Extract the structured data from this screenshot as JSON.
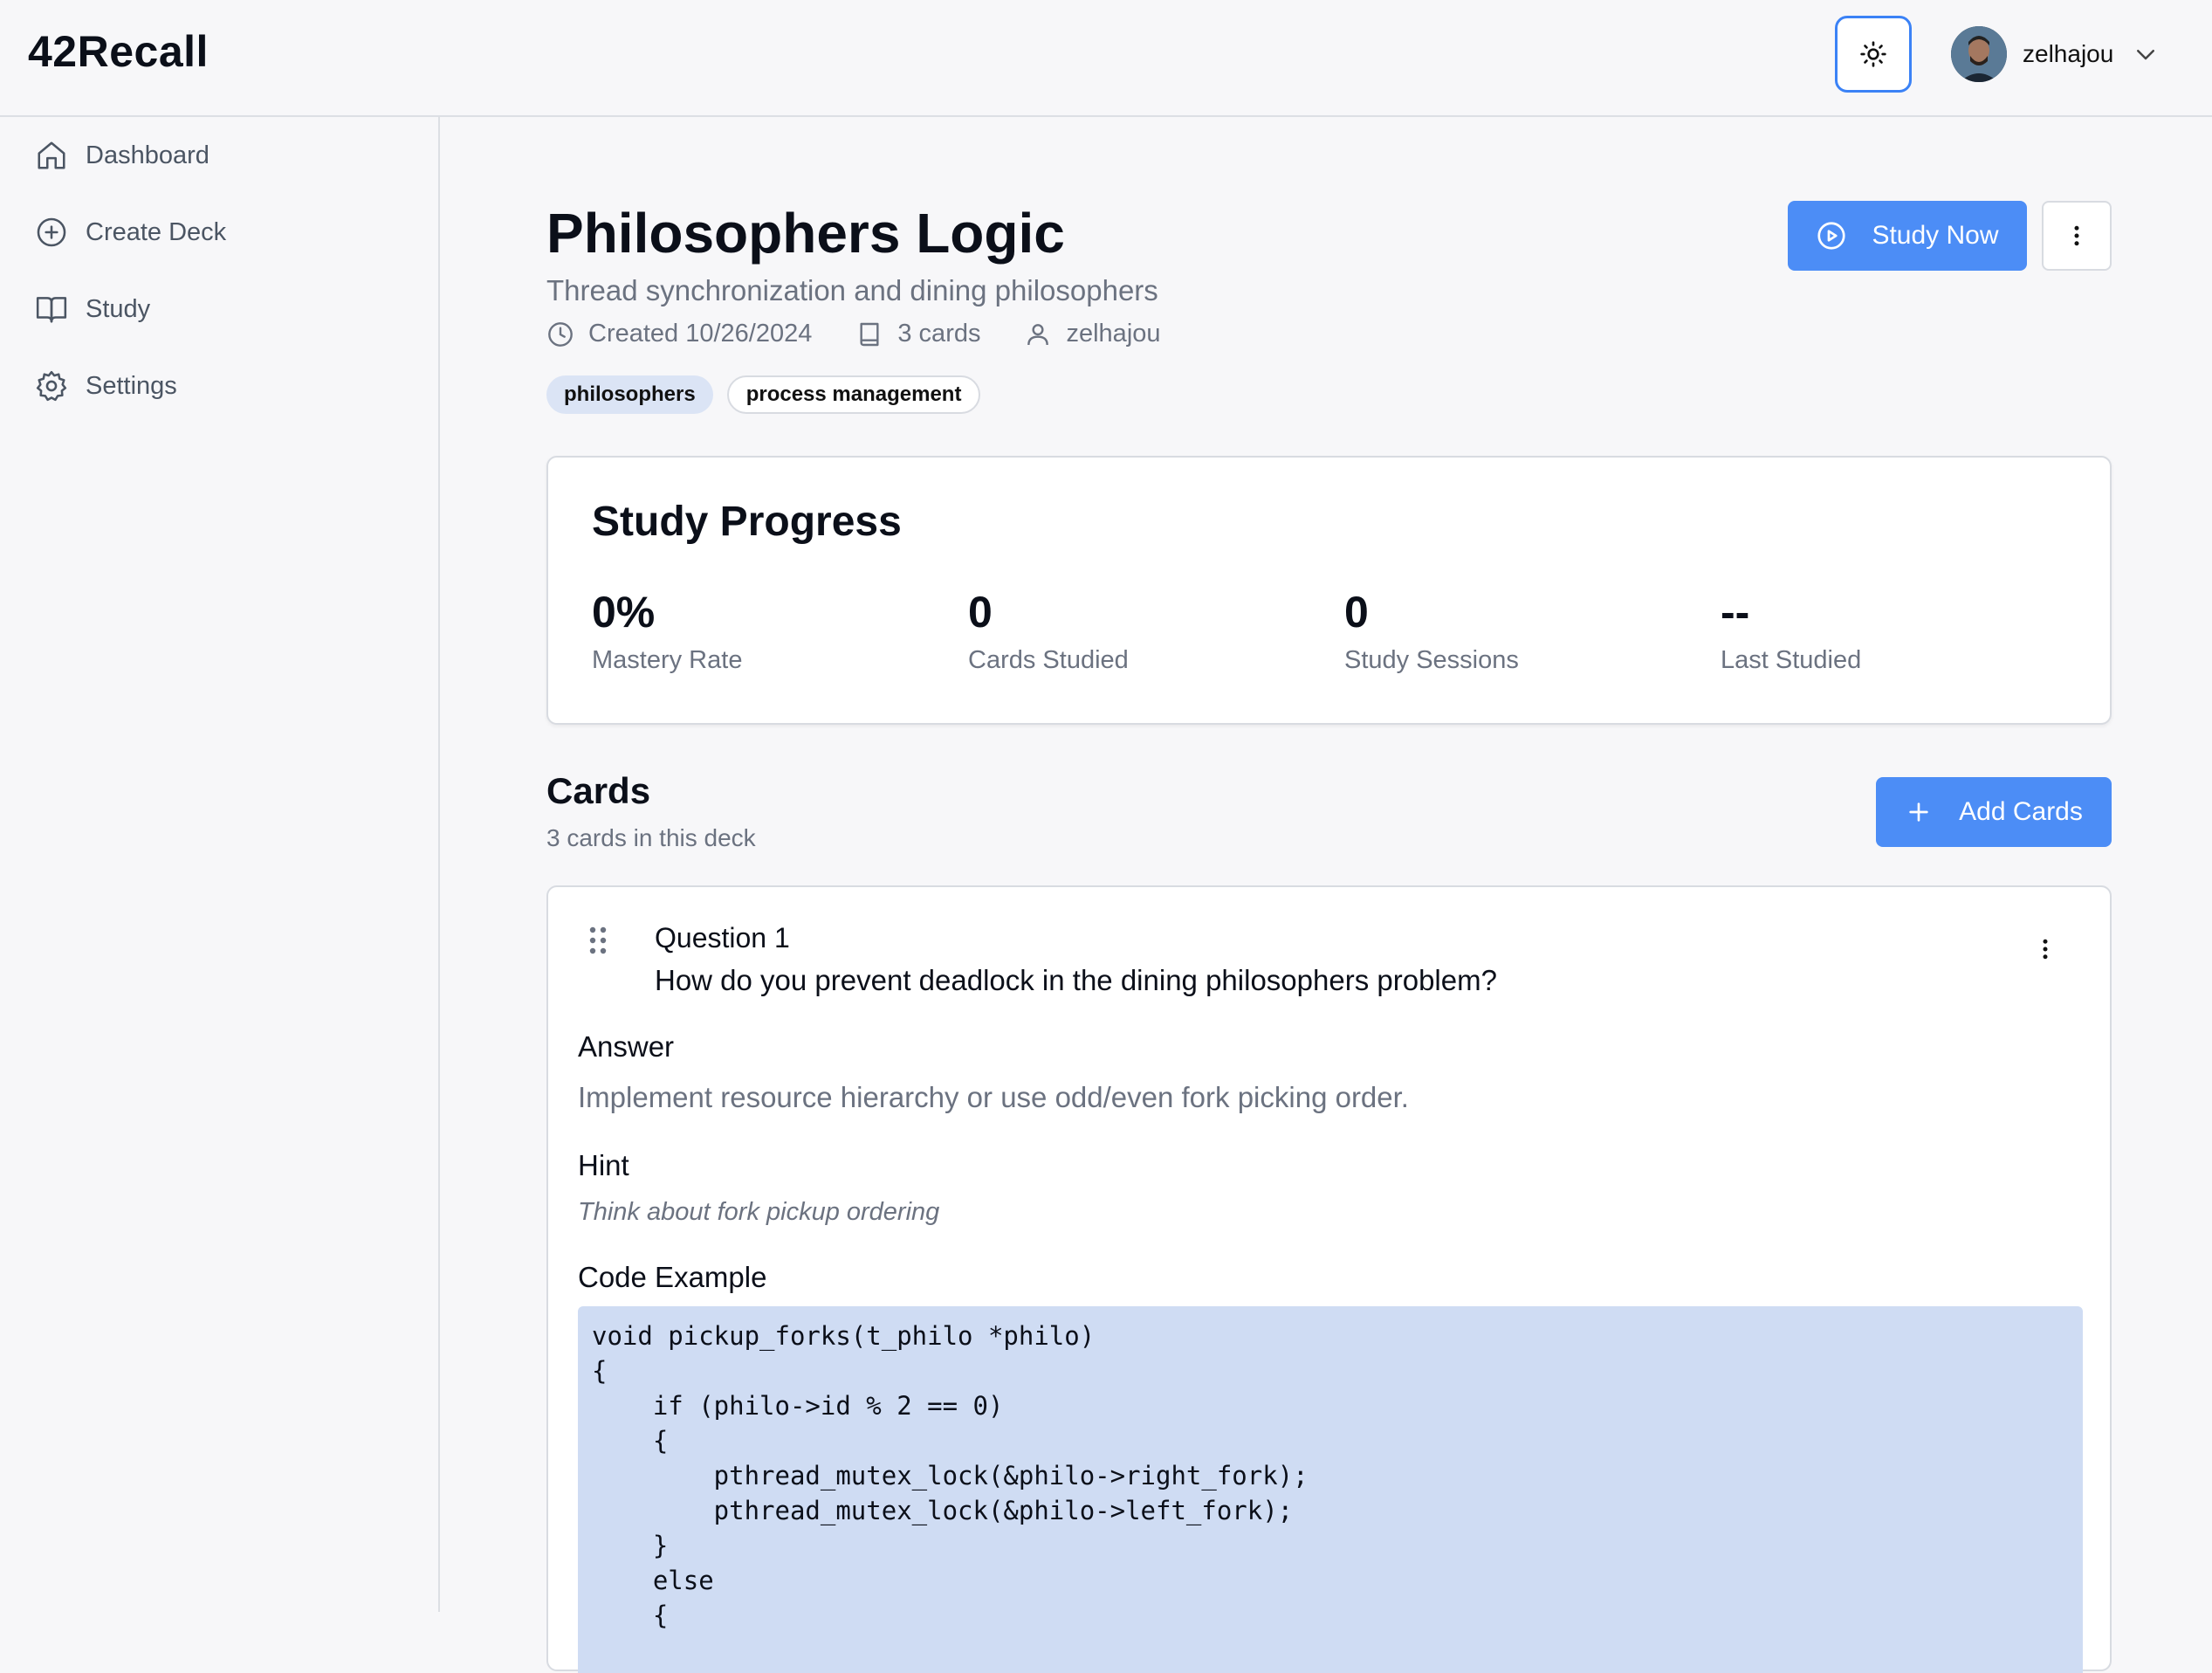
{
  "app": {
    "title": "42Recall"
  },
  "header": {
    "username": "zelhajou",
    "theme_icon": "sun-icon"
  },
  "sidebar": {
    "items": [
      {
        "label": "Dashboard",
        "icon": "home-icon"
      },
      {
        "label": "Create Deck",
        "icon": "plus-circle-icon"
      },
      {
        "label": "Study",
        "icon": "book-open-icon"
      },
      {
        "label": "Settings",
        "icon": "gear-icon"
      }
    ]
  },
  "deck": {
    "title": "Philosophers Logic",
    "description": "Thread synchronization and dining philosophers",
    "created": "Created 10/26/2024",
    "card_count": "3 cards",
    "author": "zelhajou",
    "tags": [
      "philosophers",
      "process management"
    ],
    "study_now_label": "Study Now"
  },
  "progress": {
    "title": "Study Progress",
    "stats": [
      {
        "value": "0%",
        "label": "Mastery Rate"
      },
      {
        "value": "0",
        "label": "Cards Studied"
      },
      {
        "value": "0",
        "label": "Study Sessions"
      },
      {
        "value": "--",
        "label": "Last Studied"
      }
    ]
  },
  "cards": {
    "heading": "Cards",
    "subtitle": "3 cards in this deck",
    "add_label": "Add Cards",
    "items": [
      {
        "question_label": "Question 1",
        "question": "How do you prevent deadlock in the dining philosophers problem?",
        "answer_heading": "Answer",
        "answer": "Implement resource hierarchy or use odd/even fork picking order.",
        "hint_heading": "Hint",
        "hint": "Think about fork pickup ordering",
        "code_heading": "Code Example",
        "code": "void pickup_forks(t_philo *philo)\n{\n    if (philo->id % 2 == 0)\n    {\n        pthread_mutex_lock(&philo->right_fork);\n        pthread_mutex_lock(&philo->left_fork);\n    }\n    else\n    {"
      }
    ]
  },
  "colors": {
    "accent": "#4c8df6",
    "tag_bg": "#dbe4f5",
    "code_bg": "#cfdcf3",
    "muted": "#6b7280"
  }
}
